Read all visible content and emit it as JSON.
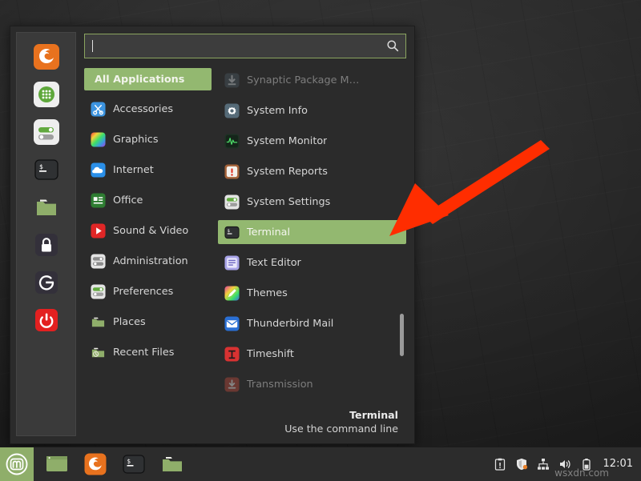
{
  "desktop": {
    "background_color": "#2e2e2e"
  },
  "menu": {
    "search": {
      "value": "",
      "placeholder": "",
      "icon": "search-icon"
    },
    "favorites": [
      {
        "name": "firefox",
        "icon": "firefox-icon"
      },
      {
        "name": "software-manager",
        "icon": "software-manager-icon"
      },
      {
        "name": "system-settings",
        "icon": "system-settings-icon"
      },
      {
        "name": "terminal",
        "icon": "terminal-icon"
      },
      {
        "name": "files",
        "icon": "folder-icon"
      },
      {
        "name": "lock-screen",
        "icon": "lock-icon"
      },
      {
        "name": "log-out",
        "icon": "logout-icon"
      },
      {
        "name": "quit",
        "icon": "power-icon"
      }
    ],
    "categories": [
      {
        "label": "All Applications",
        "icon": "all-applications-icon",
        "selected": true
      },
      {
        "label": "Accessories",
        "icon": "accessories-icon",
        "selected": false
      },
      {
        "label": "Graphics",
        "icon": "graphics-icon",
        "selected": false
      },
      {
        "label": "Internet",
        "icon": "internet-icon",
        "selected": false
      },
      {
        "label": "Office",
        "icon": "office-icon",
        "selected": false
      },
      {
        "label": "Sound & Video",
        "icon": "sound-video-icon",
        "selected": false
      },
      {
        "label": "Administration",
        "icon": "administration-icon",
        "selected": false
      },
      {
        "label": "Preferences",
        "icon": "preferences-icon",
        "selected": false
      },
      {
        "label": "Places",
        "icon": "places-icon",
        "selected": false
      },
      {
        "label": "Recent Files",
        "icon": "recent-files-icon",
        "selected": false
      }
    ],
    "applications": [
      {
        "label": "Synaptic Package M…",
        "icon": "synaptic-icon",
        "selected": false,
        "dim": true
      },
      {
        "label": "System Info",
        "icon": "system-info-icon",
        "selected": false,
        "dim": false
      },
      {
        "label": "System Monitor",
        "icon": "system-monitor-icon",
        "selected": false,
        "dim": false
      },
      {
        "label": "System Reports",
        "icon": "system-reports-icon",
        "selected": false,
        "dim": false
      },
      {
        "label": "System Settings",
        "icon": "system-settings-icon",
        "selected": false,
        "dim": false
      },
      {
        "label": "Terminal",
        "icon": "terminal-icon",
        "selected": true,
        "dim": false
      },
      {
        "label": "Text Editor",
        "icon": "text-editor-icon",
        "selected": false,
        "dim": false
      },
      {
        "label": "Themes",
        "icon": "themes-icon",
        "selected": false,
        "dim": false
      },
      {
        "label": "Thunderbird Mail",
        "icon": "thunderbird-icon",
        "selected": false,
        "dim": false
      },
      {
        "label": "Timeshift",
        "icon": "timeshift-icon",
        "selected": false,
        "dim": false
      },
      {
        "label": "Transmission",
        "icon": "transmission-icon",
        "selected": false,
        "dim": true
      }
    ],
    "status": {
      "title": "Terminal",
      "description": "Use the command line"
    },
    "accent_color": "#93b870",
    "background_color": "#2b2b2b"
  },
  "annotation": {
    "arrow_color": "#ff2d00",
    "points_at": "Terminal"
  },
  "taskbar": {
    "menu_button": {
      "label": "Menu",
      "icon": "linux-mint-logo-icon"
    },
    "window_buttons": [
      {
        "name": "window-list-item",
        "icon": "window-icon"
      },
      {
        "name": "firefox",
        "icon": "firefox-icon"
      },
      {
        "name": "terminal",
        "icon": "terminal-icon"
      },
      {
        "name": "files",
        "icon": "folder-icon"
      }
    ],
    "tray": [
      {
        "name": "update-manager",
        "icon": "clipboard-alert-icon"
      },
      {
        "name": "firewall",
        "icon": "shield-icon"
      },
      {
        "name": "network",
        "icon": "network-icon"
      },
      {
        "name": "volume",
        "icon": "speaker-icon"
      },
      {
        "name": "battery",
        "icon": "battery-icon"
      }
    ],
    "clock": "12:01"
  },
  "watermark": "wsxdn.com"
}
